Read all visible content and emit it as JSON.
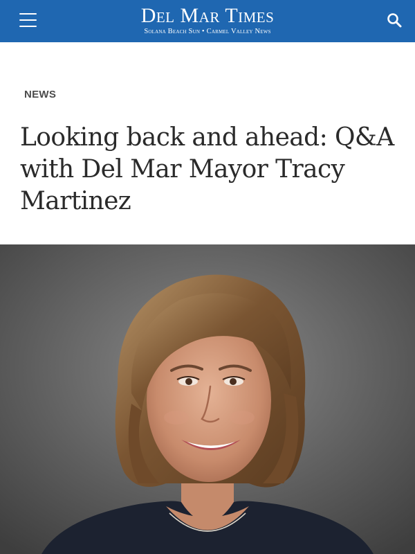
{
  "header": {
    "menu_icon": "hamburger-menu-icon",
    "search_icon": "search-icon",
    "masthead_title": "Del Mar Times",
    "masthead_subtitle": "Solana Beach Sun • Carmel Valley News",
    "background_color": "#1f67b1"
  },
  "article": {
    "category": "NEWS",
    "headline": "Looking back and ahead: Q&A with Del Mar Mayor Tracy Martinez"
  }
}
